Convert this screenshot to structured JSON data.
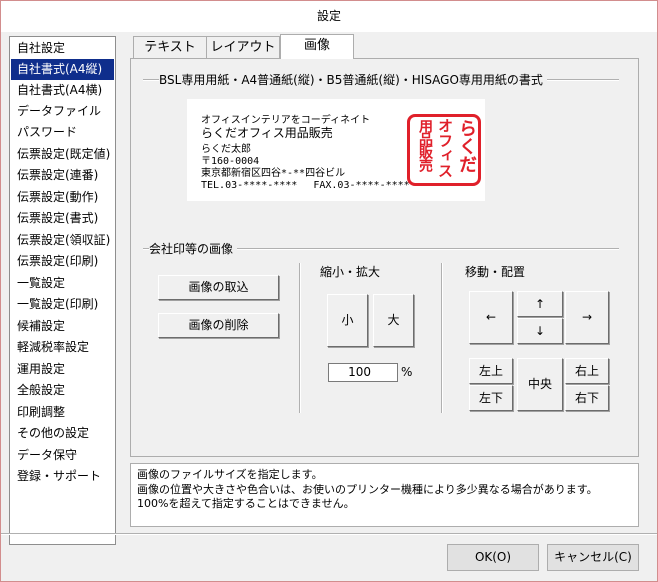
{
  "window": {
    "title": "設定"
  },
  "sidebar": {
    "items": [
      {
        "label": "自社設定",
        "selected": false
      },
      {
        "label": "自社書式(A4縦)",
        "selected": true
      },
      {
        "label": "自社書式(A4横)",
        "selected": false
      },
      {
        "label": "データファイル",
        "selected": false
      },
      {
        "label": "パスワード",
        "selected": false
      },
      {
        "label": "伝票設定(既定値)",
        "selected": false
      },
      {
        "label": "伝票設定(連番)",
        "selected": false
      },
      {
        "label": "伝票設定(動作)",
        "selected": false
      },
      {
        "label": "伝票設定(書式)",
        "selected": false
      },
      {
        "label": "伝票設定(領収証)",
        "selected": false
      },
      {
        "label": "伝票設定(印刷)",
        "selected": false
      },
      {
        "label": "一覧設定",
        "selected": false
      },
      {
        "label": "一覧設定(印刷)",
        "selected": false
      },
      {
        "label": "候補設定",
        "selected": false
      },
      {
        "label": "軽減税率設定",
        "selected": false
      },
      {
        "label": "運用設定",
        "selected": false
      },
      {
        "label": "全般設定",
        "selected": false
      },
      {
        "label": "印刷調整",
        "selected": false
      },
      {
        "label": "その他の設定",
        "selected": false
      },
      {
        "label": "データ保守",
        "selected": false
      },
      {
        "label": "登録・サポート",
        "selected": false
      }
    ]
  },
  "tabs": [
    {
      "label": "テキスト",
      "active": false
    },
    {
      "label": "レイアウト",
      "active": false
    },
    {
      "label": "画像",
      "active": true
    }
  ],
  "format_group": {
    "title": "BSL専用用紙・A4普通紙(縦)・B5普通紙(縦)・HISAGO専用用紙の書式",
    "preview": {
      "line1": "オフィスインテリアをコーディネイト",
      "line2": "らくだオフィス用品販売",
      "line3": "らくだ太郎",
      "line4": "〒160-0004",
      "line5": "東京都新宿区四谷*-**四谷ビル",
      "line6": "TEL.03-****-****　 FAX.03-****-****",
      "seal_col_right": "らくだ",
      "seal_col_mid": "オフィス",
      "seal_col_left": "用品販売"
    }
  },
  "seal_group": {
    "title": "会社印等の画像",
    "import_button": "画像の取込",
    "delete_button": "画像の削除",
    "scale": {
      "title": "縮小・拡大",
      "small_button": "小",
      "large_button": "大",
      "percent_value": "100",
      "percent_unit": "%"
    },
    "move": {
      "title": "移動・配置",
      "left_button": "←",
      "up_button": "↑",
      "down_button": "↓",
      "right_button": "→",
      "top_left_button": "左上",
      "bottom_left_button": "左下",
      "center_button": "中央",
      "top_right_button": "右上",
      "bottom_right_button": "右下"
    }
  },
  "info": {
    "line1": "画像のファイルサイズを指定します。",
    "line2": "画像の位置や大きさや色合いは、お使いのプリンター機種により多少異なる場合があります。",
    "line3": "100%を超えて指定することはできません。"
  },
  "footer": {
    "ok_button": "OK(O)",
    "cancel_button": "キャンセル(C)"
  },
  "colors": {
    "selection": "#0f2e8c",
    "seal_red": "#e0202a",
    "window_border": "#d28d8d"
  }
}
